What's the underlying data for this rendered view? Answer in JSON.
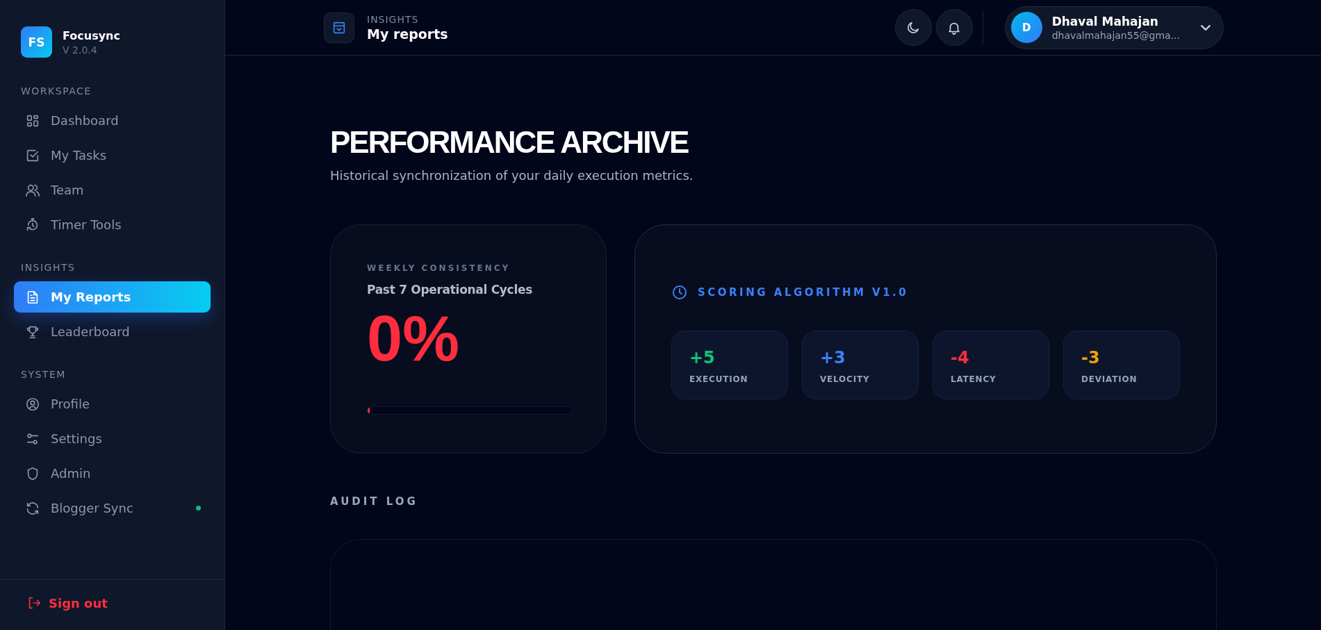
{
  "brand": {
    "logo": "FS",
    "name": "Focusync",
    "version": "V 2.0.4"
  },
  "sidebar": {
    "sections": [
      {
        "title": "WORKSPACE",
        "items": [
          {
            "label": "Dashboard",
            "selected": false
          },
          {
            "label": "My Tasks",
            "selected": false
          },
          {
            "label": "Team",
            "selected": false
          },
          {
            "label": "Timer Tools",
            "selected": false
          }
        ]
      },
      {
        "title": "INSIGHTS",
        "items": [
          {
            "label": "My Reports",
            "selected": true
          },
          {
            "label": "Leaderboard",
            "selected": false
          }
        ]
      },
      {
        "title": "SYSTEM",
        "items": [
          {
            "label": "Profile",
            "selected": false
          },
          {
            "label": "Settings",
            "selected": false
          },
          {
            "label": "Admin",
            "selected": false
          },
          {
            "label": "Blogger Sync",
            "selected": false,
            "color": "#10b981"
          }
        ]
      }
    ],
    "sign_out": "Sign out"
  },
  "header": {
    "section": "INSIGHTS",
    "title": "My reports",
    "user": {
      "initial": "D",
      "name": "Dhaval Mahajan",
      "email": "dhavalmahajan55@gma..."
    }
  },
  "page": {
    "title": "PERFORMANCE ARCHIVE",
    "subtitle": "Historical synchronization of your daily execution metrics."
  },
  "consistency": {
    "label": "WEEKLY CONSISTENCY",
    "caption": "Past 7 Operational Cycles",
    "value": "0%",
    "level": 0
  },
  "scoring": {
    "title": "SCORING ALGORITHM V1.0",
    "metrics": [
      {
        "value": "+5",
        "label": "EXECUTION",
        "color": "#10c47a"
      },
      {
        "value": "+3",
        "label": "VELOCITY",
        "color": "#3b82f6"
      },
      {
        "value": "-4",
        "label": "LATENCY",
        "color": "#ff2d3d"
      },
      {
        "value": "-3",
        "label": "DEVIATION",
        "color": "#f59e0b"
      }
    ]
  },
  "audit": {
    "title": "AUDIT LOG"
  }
}
